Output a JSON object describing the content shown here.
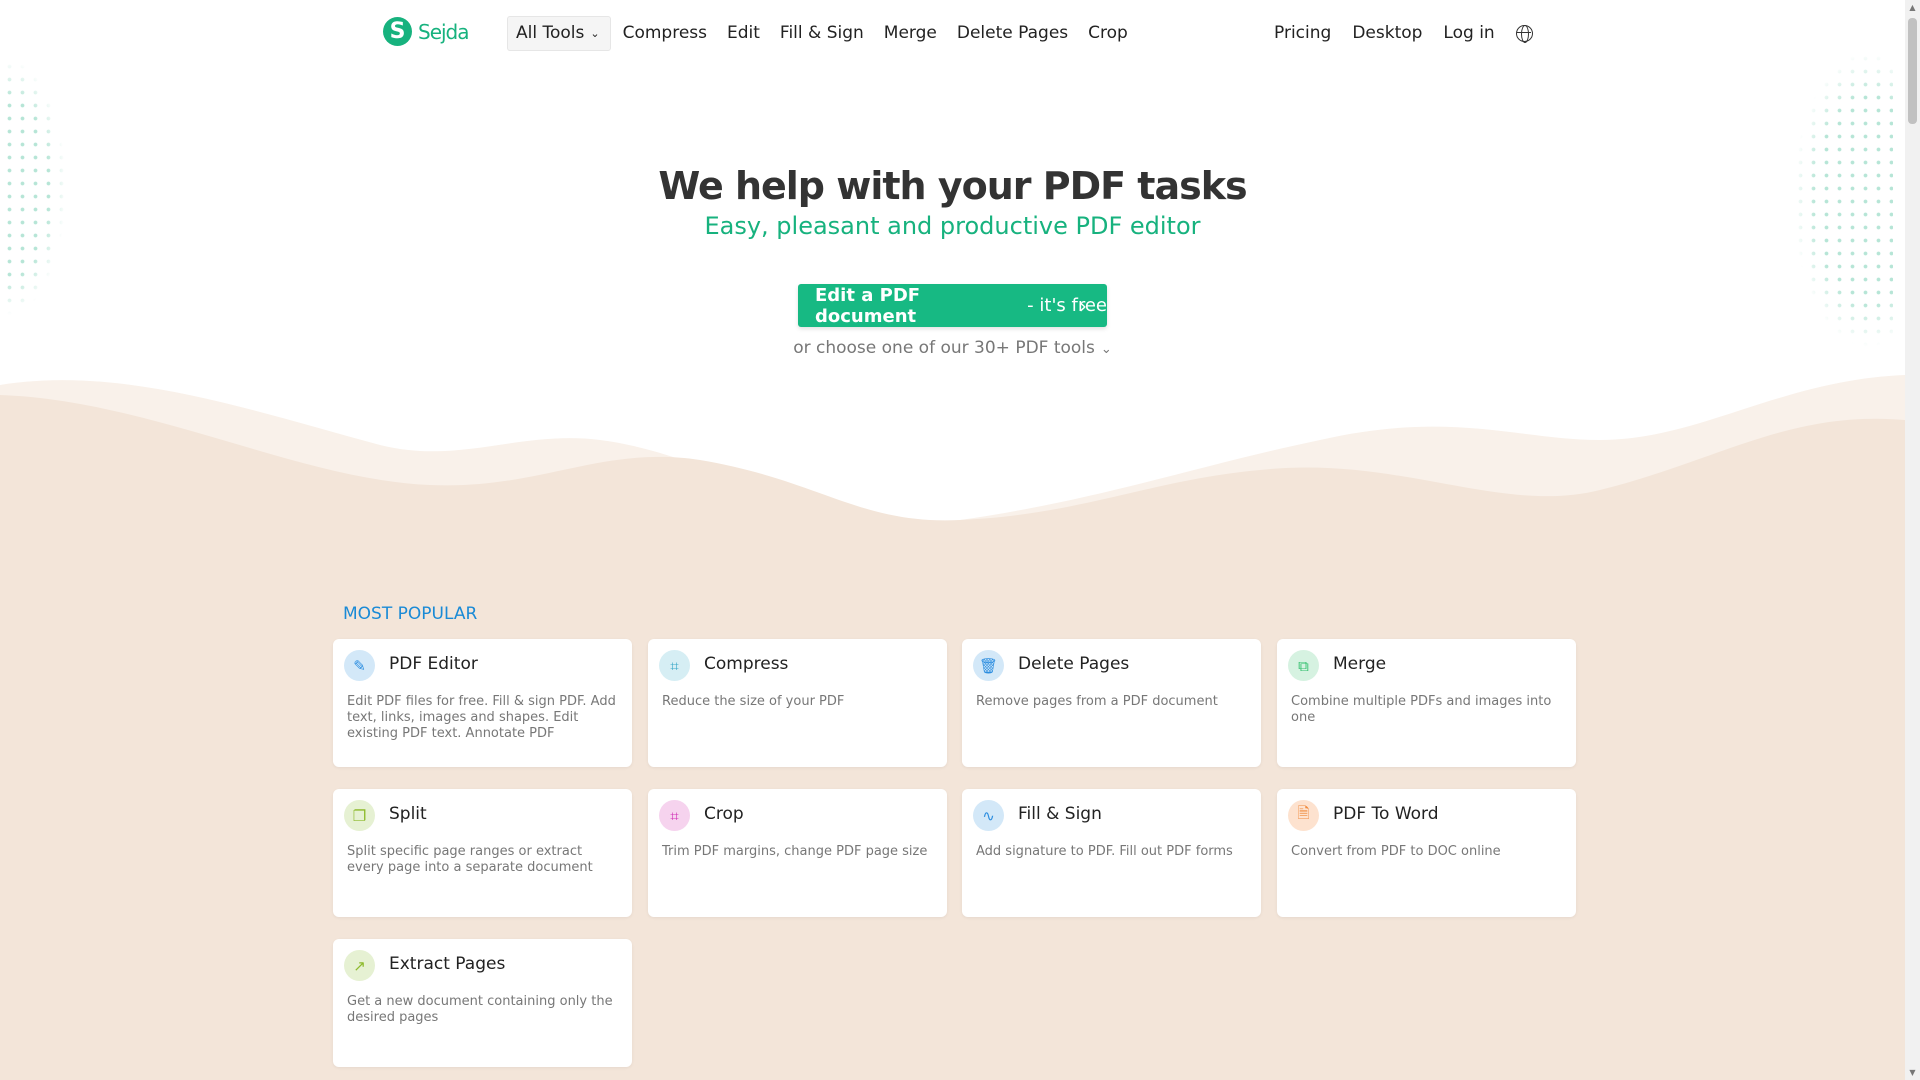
{
  "header": {
    "logo_letter": "S",
    "logo_name": "Sejda",
    "all_tools": "All Tools",
    "nav": [
      "Compress",
      "Edit",
      "Fill & Sign",
      "Merge",
      "Delete Pages",
      "Crop"
    ],
    "right": [
      "Pricing",
      "Desktop",
      "Log in"
    ]
  },
  "hero": {
    "title": "We help with your PDF tasks",
    "subtitle": "Easy, pleasant and productive PDF editor",
    "cta_bold": "Edit a PDF document",
    "cta_rest": " - it's free",
    "choose": "or choose one of our 30+ PDF tools"
  },
  "section_title": "MOST POPULAR",
  "cards": [
    {
      "title": "PDF Editor",
      "desc": "Edit PDF files for free. Fill & sign PDF. Add text, links, images and shapes. Edit existing PDF text. Annotate PDF",
      "icon": "pencil-icon",
      "color": "#2d8ee0",
      "bg": "#d3e8f8"
    },
    {
      "title": "Compress",
      "desc": "Reduce the size of your PDF",
      "icon": "compress-icon",
      "color": "#3aa8c8",
      "bg": "#d6eef4"
    },
    {
      "title": "Delete Pages",
      "desc": "Remove pages from a PDF document",
      "icon": "trash-icon",
      "color": "#2d8ee0",
      "bg": "#d3e8f8"
    },
    {
      "title": "Merge",
      "desc": "Combine multiple PDFs and images into one",
      "icon": "merge-icon",
      "color": "#2fbf6a",
      "bg": "#d6f2e1"
    },
    {
      "title": "Split",
      "desc": "Split specific page ranges or extract every page into a separate document",
      "icon": "split-icon",
      "color": "#8dba2c",
      "bg": "#e6f1d3"
    },
    {
      "title": "Crop",
      "desc": "Trim PDF margins, change PDF page size",
      "icon": "crop-icon",
      "color": "#d12fb5",
      "bg": "#f6d3ee"
    },
    {
      "title": "Fill & Sign",
      "desc": "Add signature to PDF. Fill out PDF forms",
      "icon": "signature-icon",
      "color": "#2d8ee0",
      "bg": "#d3e8f8"
    },
    {
      "title": "PDF To Word",
      "desc": "Convert from PDF to DOC online",
      "icon": "word-file-icon",
      "color": "#f08a3c",
      "bg": "#fde2cf"
    },
    {
      "title": "Extract Pages",
      "desc": "Get a new document containing only the desired pages",
      "icon": "extract-icon",
      "color": "#8dba2c",
      "bg": "#e6f1d3"
    }
  ]
}
